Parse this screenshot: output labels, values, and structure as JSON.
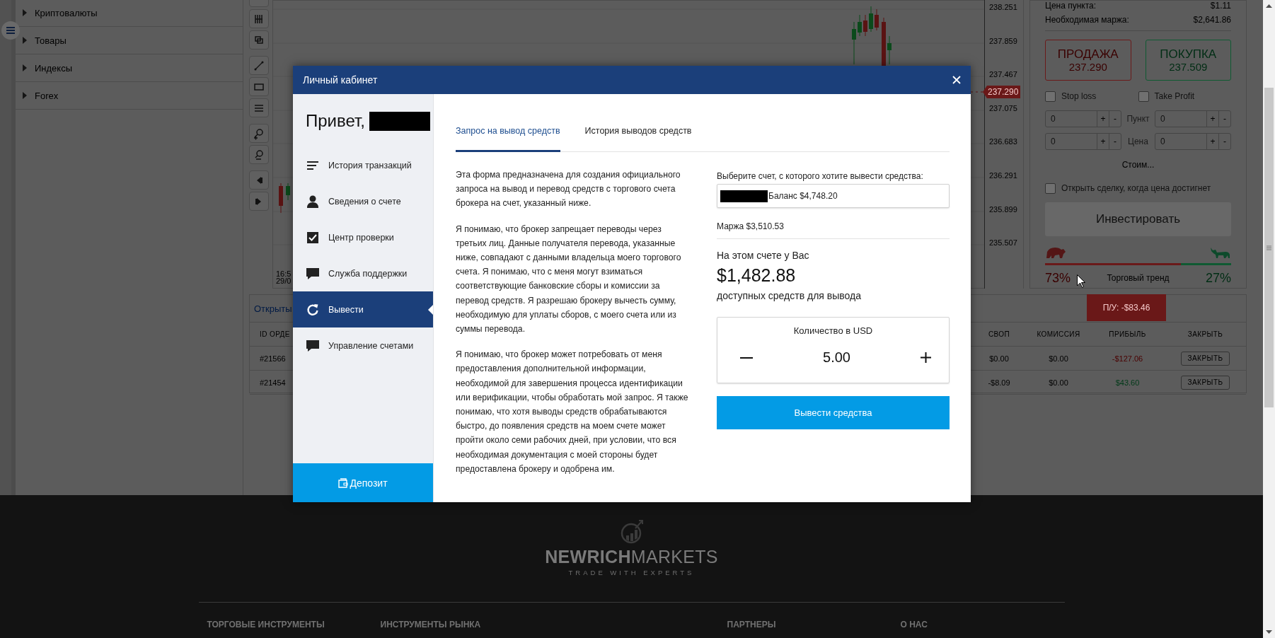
{
  "markets": [
    {
      "label": "Криптовалюты",
      "expanded": false
    },
    {
      "label": "Товары",
      "expanded": false
    },
    {
      "label": "Индексы",
      "expanded": false
    },
    {
      "label": "Forex",
      "expanded": false
    }
  ],
  "chart": {
    "price_labels": [
      "238.251",
      "237.859",
      "237.467",
      "237.075",
      "236.683",
      "236.291",
      "235.899",
      "235.507"
    ],
    "current_price": "237.290",
    "time_labels": [
      "16:5",
      "29/0"
    ]
  },
  "trade_panel": {
    "point_price_label": "Цена пункта:",
    "point_price": "$1.11",
    "margin_label": "Необходимая маржа:",
    "margin": "$2,641.86",
    "orders": [
      {
        "kind": "sell",
        "label": "ПРОДАЖА",
        "price": "237.290"
      },
      {
        "kind": "buy",
        "label": "ПОКУПКА",
        "price": "237.509"
      }
    ],
    "options": [
      {
        "label": "Stop loss",
        "checked": false
      },
      {
        "label": "Take Profit",
        "checked": false
      }
    ],
    "inputs": [
      {
        "label": "Пункт",
        "fields": [
          {
            "value": "0",
            "plus": "+",
            "minus": "-"
          },
          {
            "value": "0",
            "plus": "+",
            "minus": "-"
          }
        ]
      },
      {
        "label": "Цена",
        "fields": [
          {
            "value": "0",
            "plus": "+",
            "minus": "-"
          },
          {
            "value": "0",
            "plus": "+",
            "minus": "-"
          }
        ]
      }
    ],
    "cost": "Стоим...",
    "limit_order": {
      "label": "Открыть сделку, когда цена достигнет",
      "checked": false
    },
    "invest_button": "Инвестировать",
    "trend": {
      "level": 0.73,
      "sell_share": "73%",
      "title": "Торговый тренд",
      "buy_share": "27%"
    }
  },
  "positions": {
    "tab": "Открыты",
    "pl_badge": "П/У: -$83.46",
    "columns": [
      "ID ОРДЕ",
      "СВОП",
      "КОМИССИЯ",
      "ПРИБЫЛЬ",
      "ЗАКРЫТЬ"
    ],
    "rows": [
      {
        "id": "#21566",
        "swap": "$0.00",
        "commission": "$0.00",
        "profit": "-$127.06",
        "color": "#4a0000",
        "close": "ЗАКРЫТЬ"
      },
      {
        "id": "#21454",
        "swap": "-$8.09",
        "commission": "$0.00",
        "profit": "$43.60",
        "color": "#003a18",
        "close": "ЗАКРЫТЬ"
      }
    ]
  },
  "modal": {
    "title": "Личный кабинет",
    "greeting": "Привет,",
    "menu": [
      {
        "label": "История транзакций",
        "selected": false
      },
      {
        "label": "Сведения о счете",
        "selected": false
      },
      {
        "label": "Центр проверки",
        "selected": false
      },
      {
        "label": "Служба поддержки",
        "selected": false
      },
      {
        "label": "Вывести",
        "selected": true
      },
      {
        "label": "Управление счетами",
        "selected": false
      }
    ],
    "deposit": "Депозит",
    "tabs": [
      {
        "label": "Запрос на вывод средств",
        "selected": true
      },
      {
        "label": "История выводов средств",
        "selected": false
      }
    ],
    "paragraphs": [
      "Эта форма предназначена для создания официального запроса на вывод и перевод средств с торгового счета брокера на счет, указанный ниже.",
      "Я понимаю, что брокер запрещает переводы через третьих лиц. Данные получателя перевода, указанные ниже, совпадают с данными владельца моего торгового счета. Я понимаю, что с меня могут взиматься соответствующие банковские сборы и комиссии за перевод средств. Я разрешаю брокеру вычесть сумму, необходимую для уплаты сборов, с моего счета или из суммы перевода.",
      "Я понимаю, что брокер может потребовать от меня предоставления дополнительной информации, необходимой для завершения процесса идентификации или верификации, чтобы обработать мой запрос. Я также понимаю, что хотя выводы средств обрабатываются быстро, до появления средств на моем счете может пройти около семи рабочих дней, при условии, что вся необходимая документация с моей стороны будет предоставлена брокеру и одобрена им."
    ],
    "account_prompt": "Выберите счет, с которого хотите вывести средства:",
    "account_balance": "Баланс $4,748.20",
    "margin": "Маржа $3,510.53",
    "available_intro": "На этом счете у Вас",
    "available_amount": "$1,482.88",
    "available_caption": "доступных средств для вывода",
    "amount_label": "Количество в USD",
    "amount_value": "5.00",
    "submit": "Вывести средства"
  },
  "footer": {
    "brand": "**NEWRICH**MARKETS",
    "tagline": "TRADE WITH EXPERTS",
    "headings": [
      "ТОРГОВЫЕ ИНСТРУМЕНТЫ",
      "ИНСТРУМЕНТЫ РЫНКА",
      "ПАРТНЕРЫ",
      "О НАС"
    ]
  }
}
